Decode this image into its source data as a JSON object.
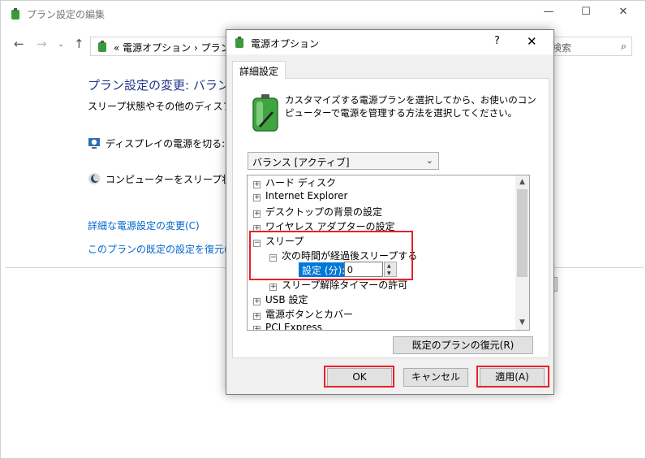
{
  "background_window": {
    "title": "プラン設定の編集",
    "breadcrumb_text": "« 電源オプション › プラン設",
    "search_placeholder": "検索",
    "heading": "プラン設定の変更: バランス",
    "description": "スリープ状態やその他のディスプレイ設",
    "rows": [
      {
        "label": "ディスプレイの電源を切る:",
        "icon": "display-clock-icon"
      },
      {
        "label": "コンピューターをスリープ状態にす",
        "icon": "moon-sleep-icon"
      }
    ],
    "links": [
      "詳細な電源設定の変更(C)",
      "このプランの既定の設定を復元(R)"
    ]
  },
  "dialog": {
    "title": "電源オプション",
    "help_glyph": "?",
    "close_glyph": "✕",
    "tab_label": "詳細設定",
    "intro_text": "カスタマイズする電源プランを選択してから、お使いのコンピューターで電源を管理する方法を選択してください。",
    "plan_selected": "バランス [アクティブ]",
    "tree": [
      {
        "label": "ハード ディスク",
        "expander": "+"
      },
      {
        "label": "Internet Explorer",
        "expander": "+"
      },
      {
        "label": "デスクトップの背景の設定",
        "expander": "+"
      },
      {
        "label": "ワイヤレス アダプターの設定",
        "expander": "+"
      },
      {
        "label": "スリープ",
        "expander": "−"
      },
      {
        "label": "次の時間が経過後スリープする",
        "expander": "−"
      },
      {
        "label": "スリープ解除タイマーの許可",
        "expander": "+"
      },
      {
        "label": "USB 設定",
        "expander": "+"
      },
      {
        "label": "電源ボタンとカバー",
        "expander": "+"
      },
      {
        "label": "PCI Express",
        "expander": "+"
      }
    ],
    "setting": {
      "label": "設定 (分):",
      "value": "0"
    },
    "restore_button": "既定のプランの復元(R)",
    "ok_button": "OK",
    "cancel_button": "キャンセル",
    "apply_button": "適用(A)"
  },
  "colors": {
    "highlight_red": "#e8212b",
    "selection_blue": "#0078d7",
    "link_blue": "#0066cc",
    "heading_blue": "#1e3287"
  }
}
